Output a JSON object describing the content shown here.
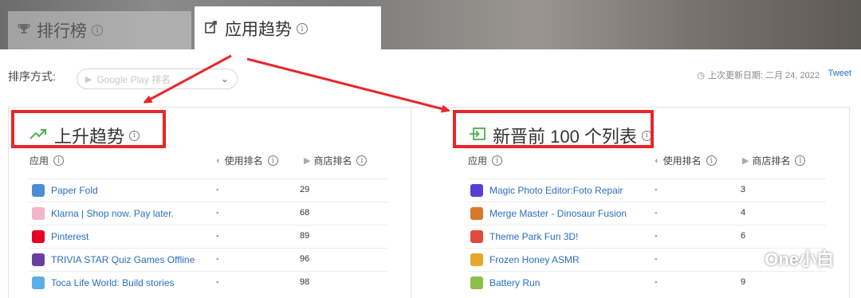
{
  "tabs": [
    {
      "label": "排行榜",
      "icon": "trophy-icon"
    },
    {
      "label": "应用趋势",
      "icon": "trend-tag-icon"
    }
  ],
  "sort": {
    "label": "排序方式:",
    "value": "Google Play 排名"
  },
  "update": {
    "text": "上次更新日期: 二月 24, 2022",
    "tweet": "Tweet"
  },
  "left_panel": {
    "title": "上升趋势",
    "columns": [
      "应用",
      "使用排名",
      "商店排名"
    ],
    "rows": [
      {
        "name": "Paper Fold",
        "usage": "-",
        "store": "29",
        "color": "#4a8fd6"
      },
      {
        "name": "Klarna | Shop now. Pay later.",
        "usage": "-",
        "store": "68",
        "color": "#f5b5c8"
      },
      {
        "name": "Pinterest",
        "usage": "-",
        "store": "89",
        "color": "#e60023"
      },
      {
        "name": "TRIVIA STAR Quiz Games Offline",
        "usage": "-",
        "store": "96",
        "color": "#6b3fa0"
      },
      {
        "name": "Toca Life World: Build stories",
        "usage": "-",
        "store": "98",
        "color": "#5ab0e6"
      }
    ]
  },
  "right_panel": {
    "title": "新晋前 100 个列表",
    "columns": [
      "应用",
      "使用排名",
      "商店排名"
    ],
    "rows": [
      {
        "name": "Magic Photo Editor:Foto Repair",
        "usage": "-",
        "store": "3",
        "color": "#5a3fd6"
      },
      {
        "name": "Merge Master - Dinosaur Fusion",
        "usage": "-",
        "store": "4",
        "color": "#d67a2a"
      },
      {
        "name": "Theme Park Fun 3D!",
        "usage": "-",
        "store": "6",
        "color": "#e04a3a"
      },
      {
        "name": "Frozen Honey ASMR",
        "usage": "-",
        "store": "",
        "color": "#e6a82a"
      },
      {
        "name": "Battery Run",
        "usage": "-",
        "store": "9",
        "color": "#8ac04a"
      }
    ]
  },
  "watermark": {
    "text": "One小白"
  },
  "colors": {
    "accent_red": "#e8262a",
    "link_blue": "#2a6ebb",
    "trend_green": "#4caf50"
  }
}
